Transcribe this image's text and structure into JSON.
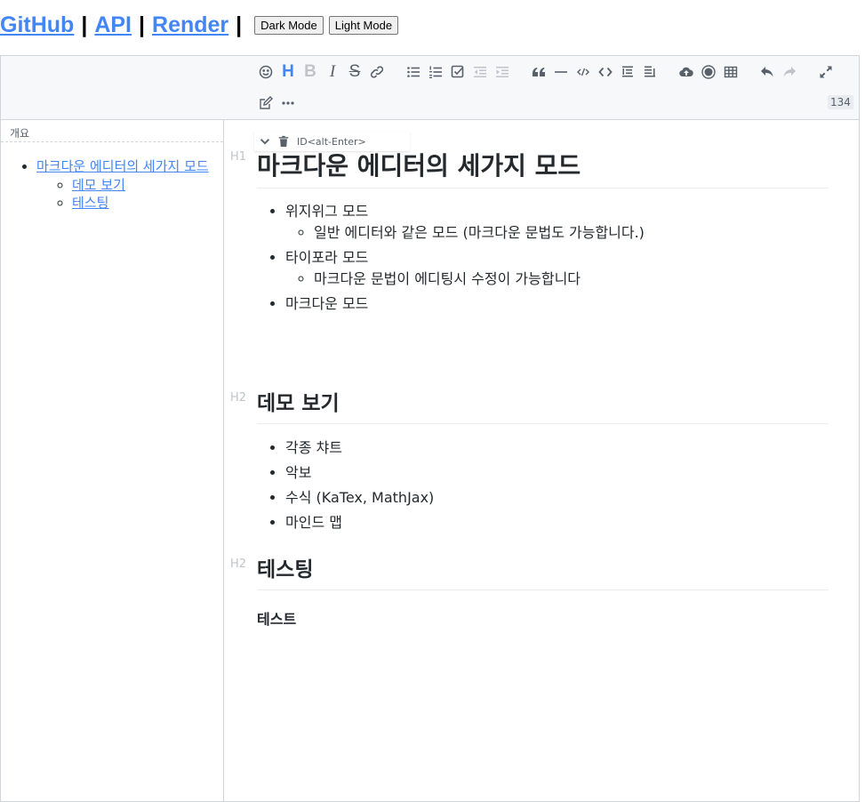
{
  "nav": {
    "github": "GitHub",
    "api": "API",
    "render": "Render",
    "separator": "|",
    "dark_mode": "Dark Mode",
    "light_mode": "Light Mode"
  },
  "toolbar": {
    "counter": "134",
    "heading_label": "H",
    "bold_label": "B",
    "italic_label": "I",
    "strike_label": "S"
  },
  "outline": {
    "title": "개요",
    "items": [
      {
        "label": "마크다운 에디터의 세가지 모드"
      },
      {
        "label": "데모 보기"
      },
      {
        "label": "테스팅"
      }
    ]
  },
  "content": {
    "block_hint": "ID<alt-Enter>",
    "h1_marker": "H1",
    "h2_marker": "H2",
    "title": "마크다운 에디터의 세가지 모드",
    "modes": [
      {
        "label": "위지위그 모드",
        "sub": "일반 에디터와 같은 모드 (마크다운 문법도 가능합니다.)"
      },
      {
        "label": "타이포라 모드",
        "sub": "마크다운 문법이 에디팅시 수정이 가능합니다"
      },
      {
        "label": "마크다운 모드"
      }
    ],
    "demo_heading": "데모 보기",
    "demo_items": [
      "각종 챠트",
      "악보",
      "수식 (KaTex, MathJax)",
      "마인드 맵"
    ],
    "test_heading": "테스팅",
    "test_text": "테스트"
  },
  "colors": {
    "link": "#4285f4",
    "toolbar_bg": "#f6f8fa",
    "border": "#d1d5da",
    "icon": "#586069",
    "disabled_icon": "#c0c4c9"
  },
  "icons": [
    "emoji-icon",
    "heading-icon",
    "bold-icon",
    "italic-icon",
    "strike-icon",
    "link-icon",
    "bullet-list-icon",
    "ordered-list-icon",
    "check-list-icon",
    "outdent-icon",
    "indent-icon",
    "quote-icon",
    "horizontal-rule-icon",
    "inline-code-icon",
    "code-block-icon",
    "insert-before-icon",
    "insert-after-icon",
    "upload-icon",
    "record-icon",
    "table-icon",
    "undo-icon",
    "redo-icon",
    "fullscreen-icon",
    "edit-mode-icon",
    "more-icon",
    "chevron-down-icon",
    "trash-icon"
  ]
}
